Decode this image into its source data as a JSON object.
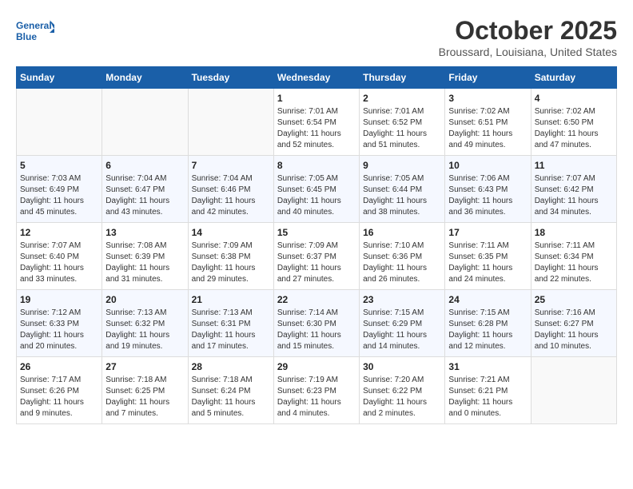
{
  "header": {
    "logo_line1": "General",
    "logo_line2": "Blue",
    "month_title": "October 2025",
    "subtitle": "Broussard, Louisiana, United States"
  },
  "weekdays": [
    "Sunday",
    "Monday",
    "Tuesday",
    "Wednesday",
    "Thursday",
    "Friday",
    "Saturday"
  ],
  "weeks": [
    [
      {
        "day": "",
        "info": ""
      },
      {
        "day": "",
        "info": ""
      },
      {
        "day": "",
        "info": ""
      },
      {
        "day": "1",
        "info": "Sunrise: 7:01 AM\nSunset: 6:54 PM\nDaylight: 11 hours and 52 minutes."
      },
      {
        "day": "2",
        "info": "Sunrise: 7:01 AM\nSunset: 6:52 PM\nDaylight: 11 hours and 51 minutes."
      },
      {
        "day": "3",
        "info": "Sunrise: 7:02 AM\nSunset: 6:51 PM\nDaylight: 11 hours and 49 minutes."
      },
      {
        "day": "4",
        "info": "Sunrise: 7:02 AM\nSunset: 6:50 PM\nDaylight: 11 hours and 47 minutes."
      }
    ],
    [
      {
        "day": "5",
        "info": "Sunrise: 7:03 AM\nSunset: 6:49 PM\nDaylight: 11 hours and 45 minutes."
      },
      {
        "day": "6",
        "info": "Sunrise: 7:04 AM\nSunset: 6:47 PM\nDaylight: 11 hours and 43 minutes."
      },
      {
        "day": "7",
        "info": "Sunrise: 7:04 AM\nSunset: 6:46 PM\nDaylight: 11 hours and 42 minutes."
      },
      {
        "day": "8",
        "info": "Sunrise: 7:05 AM\nSunset: 6:45 PM\nDaylight: 11 hours and 40 minutes."
      },
      {
        "day": "9",
        "info": "Sunrise: 7:05 AM\nSunset: 6:44 PM\nDaylight: 11 hours and 38 minutes."
      },
      {
        "day": "10",
        "info": "Sunrise: 7:06 AM\nSunset: 6:43 PM\nDaylight: 11 hours and 36 minutes."
      },
      {
        "day": "11",
        "info": "Sunrise: 7:07 AM\nSunset: 6:42 PM\nDaylight: 11 hours and 34 minutes."
      }
    ],
    [
      {
        "day": "12",
        "info": "Sunrise: 7:07 AM\nSunset: 6:40 PM\nDaylight: 11 hours and 33 minutes."
      },
      {
        "day": "13",
        "info": "Sunrise: 7:08 AM\nSunset: 6:39 PM\nDaylight: 11 hours and 31 minutes."
      },
      {
        "day": "14",
        "info": "Sunrise: 7:09 AM\nSunset: 6:38 PM\nDaylight: 11 hours and 29 minutes."
      },
      {
        "day": "15",
        "info": "Sunrise: 7:09 AM\nSunset: 6:37 PM\nDaylight: 11 hours and 27 minutes."
      },
      {
        "day": "16",
        "info": "Sunrise: 7:10 AM\nSunset: 6:36 PM\nDaylight: 11 hours and 26 minutes."
      },
      {
        "day": "17",
        "info": "Sunrise: 7:11 AM\nSunset: 6:35 PM\nDaylight: 11 hours and 24 minutes."
      },
      {
        "day": "18",
        "info": "Sunrise: 7:11 AM\nSunset: 6:34 PM\nDaylight: 11 hours and 22 minutes."
      }
    ],
    [
      {
        "day": "19",
        "info": "Sunrise: 7:12 AM\nSunset: 6:33 PM\nDaylight: 11 hours and 20 minutes."
      },
      {
        "day": "20",
        "info": "Sunrise: 7:13 AM\nSunset: 6:32 PM\nDaylight: 11 hours and 19 minutes."
      },
      {
        "day": "21",
        "info": "Sunrise: 7:13 AM\nSunset: 6:31 PM\nDaylight: 11 hours and 17 minutes."
      },
      {
        "day": "22",
        "info": "Sunrise: 7:14 AM\nSunset: 6:30 PM\nDaylight: 11 hours and 15 minutes."
      },
      {
        "day": "23",
        "info": "Sunrise: 7:15 AM\nSunset: 6:29 PM\nDaylight: 11 hours and 14 minutes."
      },
      {
        "day": "24",
        "info": "Sunrise: 7:15 AM\nSunset: 6:28 PM\nDaylight: 11 hours and 12 minutes."
      },
      {
        "day": "25",
        "info": "Sunrise: 7:16 AM\nSunset: 6:27 PM\nDaylight: 11 hours and 10 minutes."
      }
    ],
    [
      {
        "day": "26",
        "info": "Sunrise: 7:17 AM\nSunset: 6:26 PM\nDaylight: 11 hours and 9 minutes."
      },
      {
        "day": "27",
        "info": "Sunrise: 7:18 AM\nSunset: 6:25 PM\nDaylight: 11 hours and 7 minutes."
      },
      {
        "day": "28",
        "info": "Sunrise: 7:18 AM\nSunset: 6:24 PM\nDaylight: 11 hours and 5 minutes."
      },
      {
        "day": "29",
        "info": "Sunrise: 7:19 AM\nSunset: 6:23 PM\nDaylight: 11 hours and 4 minutes."
      },
      {
        "day": "30",
        "info": "Sunrise: 7:20 AM\nSunset: 6:22 PM\nDaylight: 11 hours and 2 minutes."
      },
      {
        "day": "31",
        "info": "Sunrise: 7:21 AM\nSunset: 6:21 PM\nDaylight: 11 hours and 0 minutes."
      },
      {
        "day": "",
        "info": ""
      }
    ]
  ]
}
